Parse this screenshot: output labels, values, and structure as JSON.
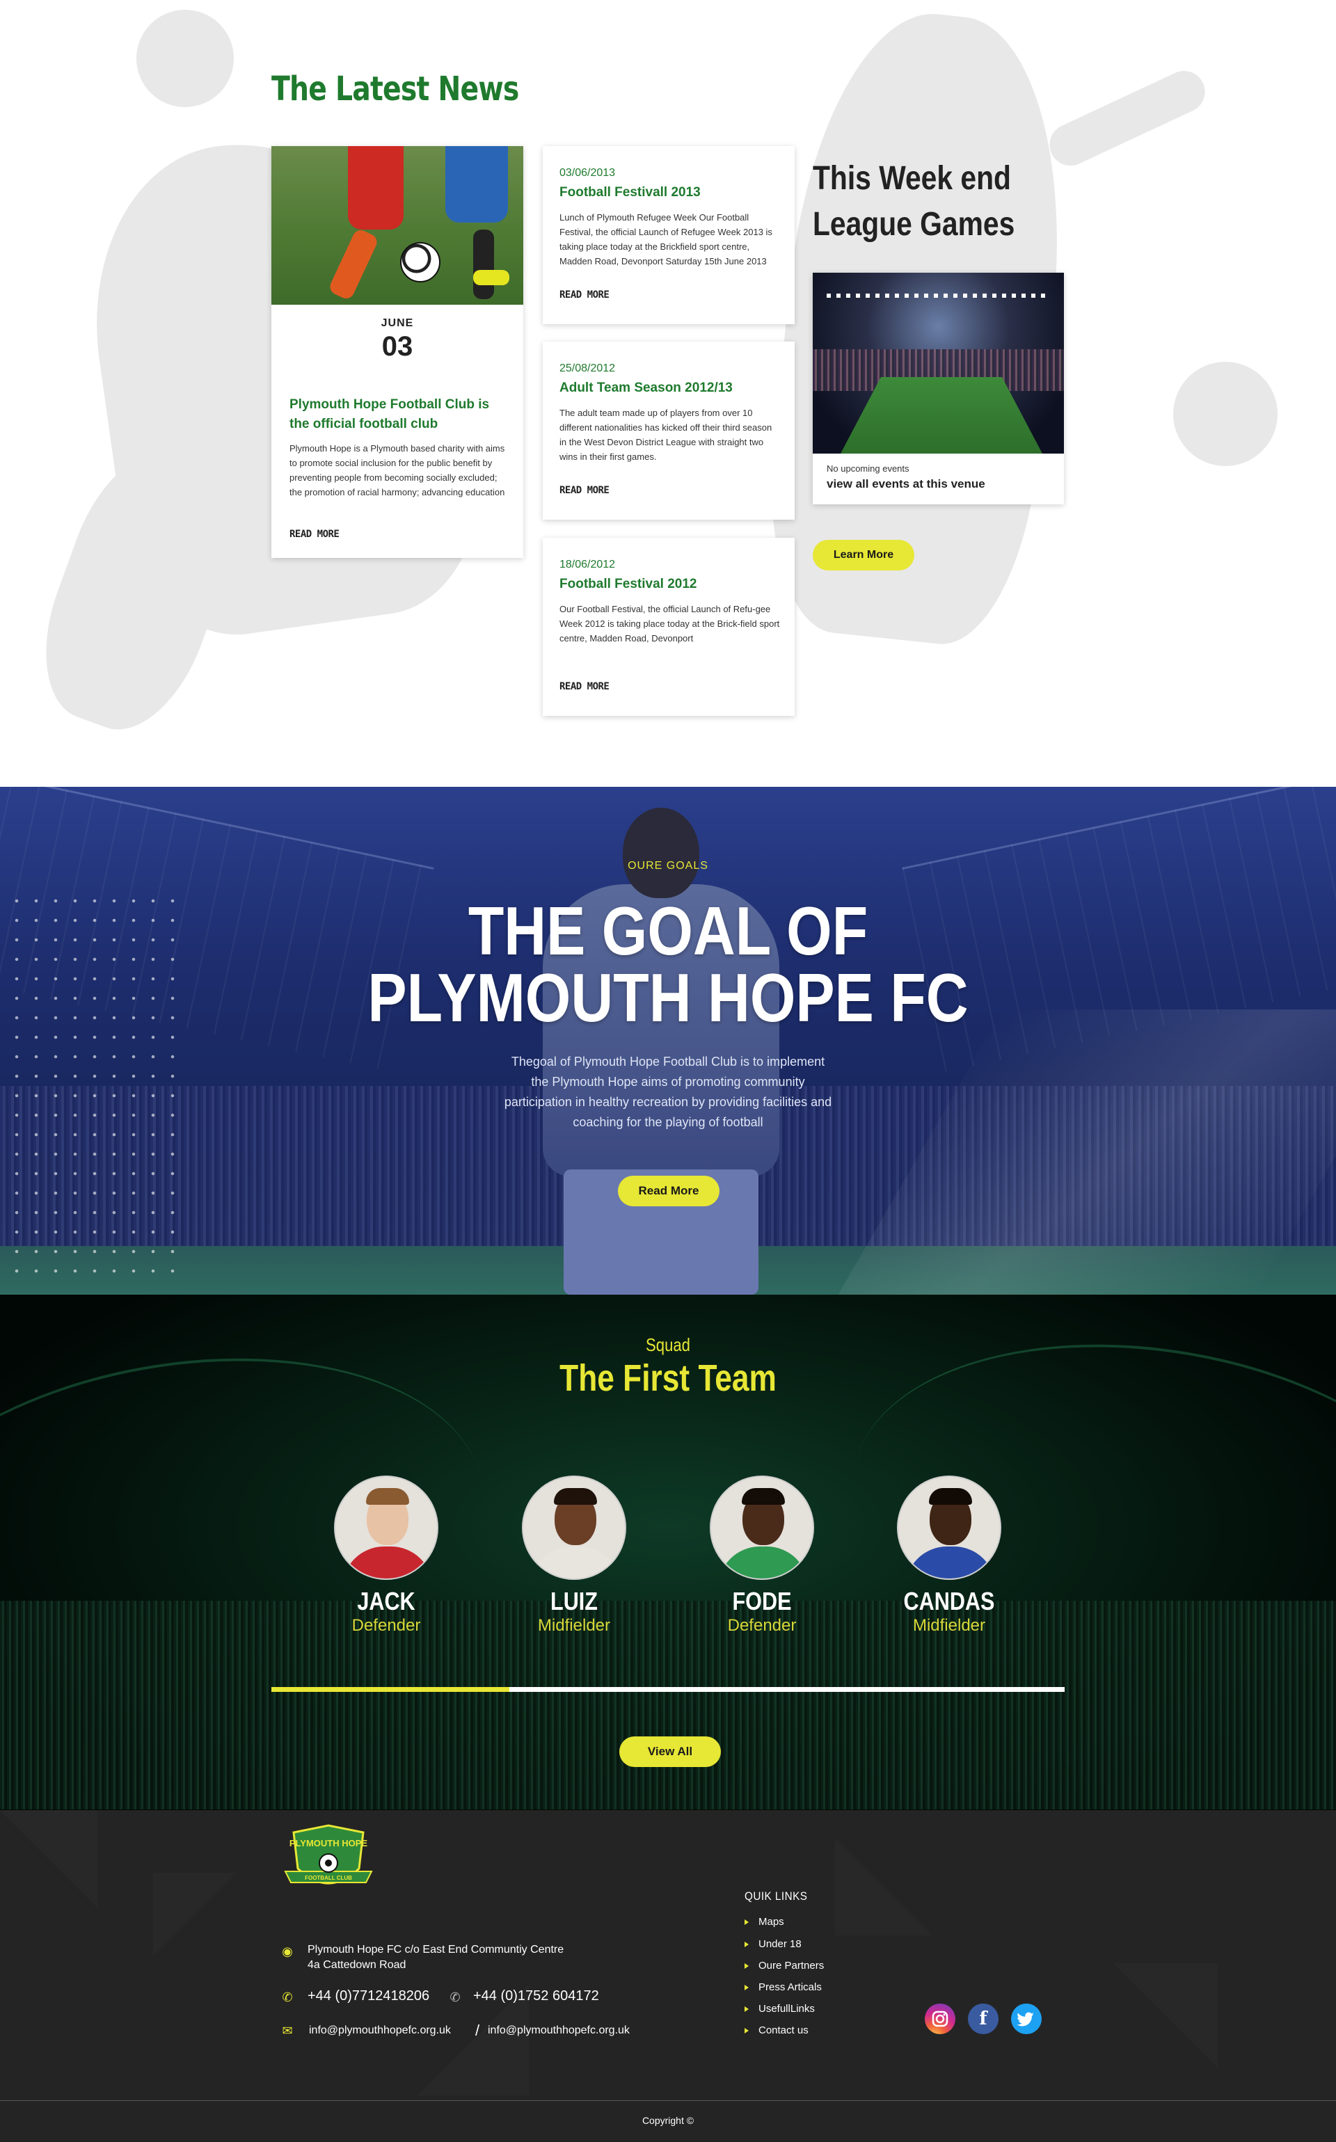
{
  "news": {
    "title": "The Latest News",
    "feature": {
      "month": "JUNE",
      "day": "03",
      "headline": "Plymouth Hope Football Club is the official football club",
      "body": "Plymouth Hope is a Plymouth based charity with aims to promote social inclusion for the public benefit by preventing people from becoming socially excluded; the promotion of racial harmony; advancing education",
      "read_more": "READ MORE"
    },
    "items": [
      {
        "date": "03/06/2013",
        "title": "Football Festivall 2013",
        "body": "Lunch of Plymouth Refugee Week Our Football Festival, the official Launch of Refugee Week 2013 is taking place today at the Brickfield sport centre, Madden Road, Devonport Saturday 15th June 2013",
        "read_more": "READ MORE"
      },
      {
        "date": "25/08/2012",
        "title": "Adult Team Season 2012/13",
        "body": "The adult team made up of players from over 10 different nationalities has kicked off their third season in the West Devon District League with straight two wins in their first games.",
        "read_more": "READ MORE"
      },
      {
        "date": "18/06/2012",
        "title": "Football Festival 2012",
        "body": "Our Football Festival, the official Launch of Refu-gee Week 2012 is taking place today at the Brick-field sport centre, Madden Road, Devonport",
        "read_more": "READ MORE"
      }
    ]
  },
  "games": {
    "title": "This Week end League Games",
    "no_events": "No upcoming events",
    "venue_link": "view all events at this venue",
    "learn_more": "Learn More"
  },
  "goal": {
    "eyebrow": "OURE GOALS",
    "heading_line1": "THE GOAL OF",
    "heading_line2": "PLYMOUTH HOPE FC",
    "body": "Thegoal of Plymouth Hope Football Club is to implement the Plymouth Hope aims of promoting community participation in healthy recreation by providing facilities and coaching for the playing of football",
    "read_more": "Read More"
  },
  "squad": {
    "eyebrow": "Squad",
    "title": "The First Team",
    "players": [
      {
        "name": "JACK",
        "role": "Defender",
        "shirt": "#c8262e",
        "skin": "#e8c2a4",
        "hair": "#8a5a30"
      },
      {
        "name": "LUIZ",
        "role": "Midfielder",
        "shirt": "#e8e4de",
        "skin": "#6a3f26",
        "hair": "#1e120a"
      },
      {
        "name": "FODE",
        "role": "Defender",
        "shirt": "#2e9a52",
        "skin": "#4a2b1a",
        "hair": "#140c06"
      },
      {
        "name": "CANDAS",
        "role": "Midfielder",
        "shirt": "#2a4ca8",
        "skin": "#3f2515",
        "hair": "#120a05"
      }
    ],
    "slider_progress": 0.3,
    "view_all": "View All"
  },
  "footer": {
    "crest_text_top": "PLYMOUTH HOPE",
    "crest_text_bottom": "FOOTBALL CLUB",
    "address_line1": "Plymouth Hope FC c/o East End Communtiy Centre",
    "address_line2": "4a Cattedown Road",
    "phone1": "+44 (0)7712418206",
    "phone2": "+44 (0)1752 604172",
    "email1": "info@plymouthhopefc.org.uk",
    "email_sep": "/",
    "email2": "info@plymouthhopefc.org.uk",
    "links_title": "QUIK LINKS",
    "links": [
      "Maps",
      "Under 18",
      "Oure Partners",
      "Press Articals",
      "UsefullLinks",
      "Contact us"
    ],
    "social": {
      "instagram": "instagram-icon",
      "facebook": "f",
      "twitter": "twitter-icon"
    },
    "copyright": "Copyright ©"
  },
  "colors": {
    "brand_green": "#1f7a2e",
    "accent_yellow": "#e7e735",
    "footer_bg": "#242424"
  }
}
